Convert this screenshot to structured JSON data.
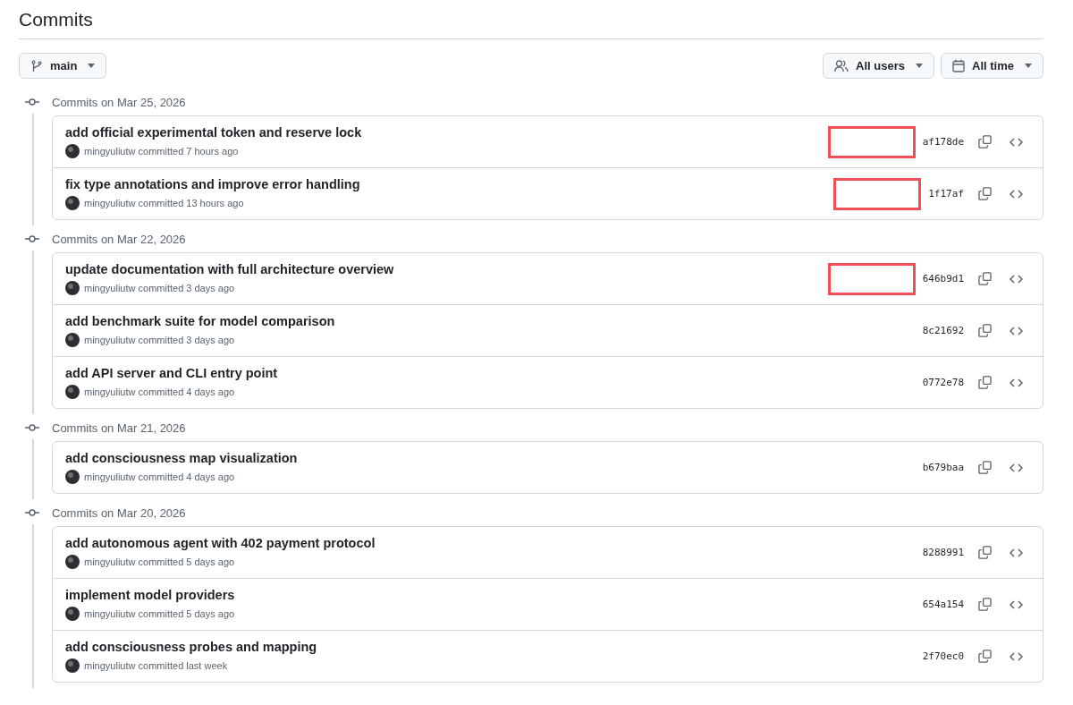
{
  "title": "Commits",
  "branch": "main",
  "filters": [
    {
      "kind": "users",
      "label": "All users"
    },
    {
      "kind": "time",
      "label": "All time"
    }
  ],
  "groups": [
    {
      "heading": "Commits on Mar 25, 2026",
      "commits": [
        {
          "message": "add official experimental token and reserve lock",
          "author": "mingyuliutw",
          "action": "committed",
          "when": "7 hours ago",
          "sha": "af178de",
          "redacted": true
        },
        {
          "message": "fix type annotations and improve error handling",
          "author": "mingyuliutw",
          "action": "committed",
          "when": "13 hours ago",
          "sha": "1f17af",
          "redacted": true
        }
      ]
    },
    {
      "heading": "Commits on Mar 22, 2026",
      "commits": [
        {
          "message": "update documentation with full architecture overview",
          "author": "mingyuliutw",
          "action": "committed",
          "when": "3 days ago",
          "sha": "646b9d1",
          "redacted": true
        },
        {
          "message": "add benchmark suite for model comparison",
          "author": "mingyuliutw",
          "action": "committed",
          "when": "3 days ago",
          "sha": "8c21692",
          "redacted": false
        },
        {
          "message": "add API server and CLI entry point",
          "author": "mingyuliutw",
          "action": "committed",
          "when": "4 days ago",
          "sha": "0772e78",
          "redacted": false
        }
      ]
    },
    {
      "heading": "Commits on Mar 21, 2026",
      "commits": [
        {
          "message": "add consciousness map visualization",
          "author": "mingyuliutw",
          "action": "committed",
          "when": "4 days ago",
          "sha": "b679baa",
          "redacted": false
        }
      ]
    },
    {
      "heading": "Commits on Mar 20, 2026",
      "commits": [
        {
          "message": "add autonomous agent with 402 payment protocol",
          "author": "mingyuliutw",
          "action": "committed",
          "when": "5 days ago",
          "sha": "8288991",
          "redacted": false
        },
        {
          "message": "implement model providers",
          "author": "mingyuliutw",
          "action": "committed",
          "when": "5 days ago",
          "sha": "654a154",
          "redacted": false
        },
        {
          "message": "add consciousness probes and mapping",
          "author": "mingyuliutw",
          "action": "committed",
          "when": "last week",
          "sha": "2f70ec0",
          "redacted": false
        }
      ]
    }
  ]
}
